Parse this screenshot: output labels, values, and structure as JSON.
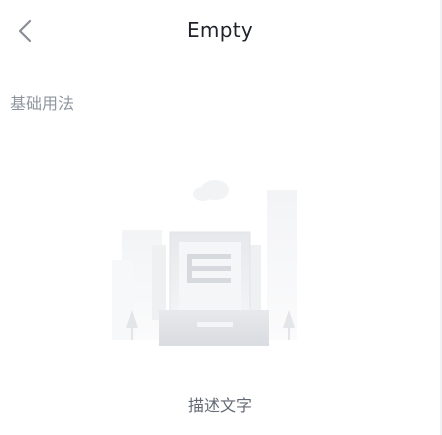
{
  "navbar": {
    "title": "Empty",
    "back_icon": "chevron-left-icon"
  },
  "section": {
    "title": "基础用法"
  },
  "empty": {
    "illustration_icon": "empty-document-illustration",
    "description": "描述文字"
  },
  "colors": {
    "title": "#1f2329",
    "section_title": "#8f959e",
    "description": "#646a73",
    "background": "#ffffff"
  }
}
